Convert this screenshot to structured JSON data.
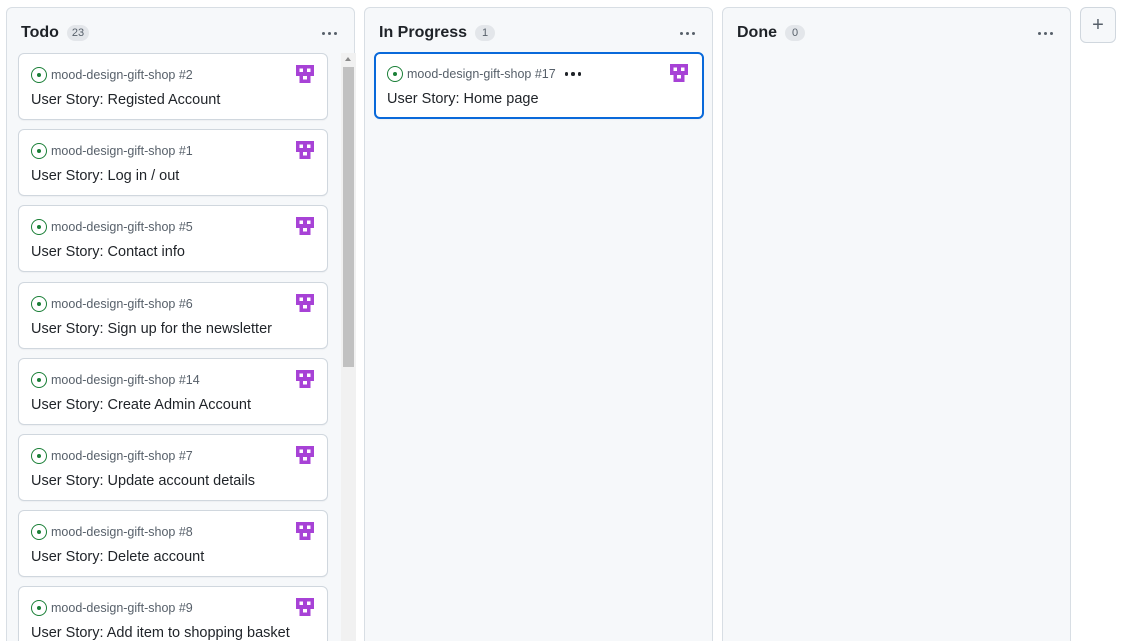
{
  "columns": [
    {
      "title": "Todo",
      "count": "23",
      "cards": [
        {
          "repo": "mood-design-gift-shop #2",
          "title": "User Story: Registed Account"
        },
        {
          "repo": "mood-design-gift-shop #1",
          "title": "User Story: Log in / out"
        },
        {
          "repo": "mood-design-gift-shop #5",
          "title": "User Story: Contact info"
        },
        {
          "repo": "mood-design-gift-shop #6",
          "title": "User Story: Sign up for the newsletter"
        },
        {
          "repo": "mood-design-gift-shop #14",
          "title": "User Story: Create Admin Account"
        },
        {
          "repo": "mood-design-gift-shop #7",
          "title": "User Story: Update account details"
        },
        {
          "repo": "mood-design-gift-shop #8",
          "title": "User Story: Delete account"
        },
        {
          "repo": "mood-design-gift-shop #9",
          "title": "User Story: Add item to shopping basket"
        }
      ]
    },
    {
      "title": "In Progress",
      "count": "1",
      "cards": [
        {
          "repo": "mood-design-gift-shop #17",
          "title": "User Story: Home page"
        }
      ]
    },
    {
      "title": "Done",
      "count": "0",
      "cards": []
    }
  ],
  "add_column_label": "+",
  "colors": {
    "open_issue": "#1a7f37",
    "active_border": "#0969da",
    "avatar": "#a742d6"
  },
  "icons": {
    "issue_status": "issue-opened-icon",
    "assignee": "identicon-avatar",
    "menu": "kebab-horizontal-icon"
  }
}
